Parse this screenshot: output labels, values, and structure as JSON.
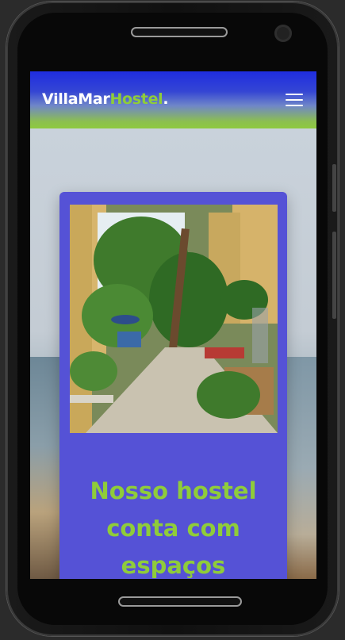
{
  "navbar": {
    "logo_part1": "VillaMar",
    "logo_part2": "Hostel",
    "logo_part3": ".",
    "menu_icon": "hamburger-menu-icon"
  },
  "hero": {
    "photo": "hostel-courtyard-garden-photo",
    "title_line1": "Nosso hostel",
    "title_line2": "conta com",
    "title_line3": "espaços"
  },
  "colors": {
    "brand_green": "#8fcc3a",
    "card_purple": "#5552d6",
    "nav_blue": "#1f2de0"
  }
}
